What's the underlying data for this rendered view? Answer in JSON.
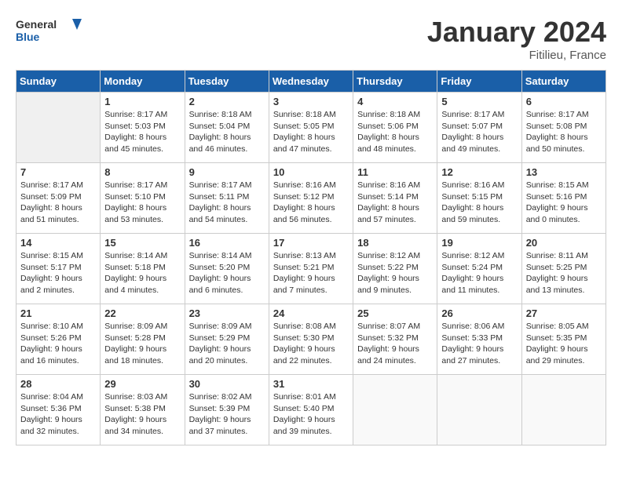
{
  "header": {
    "logo_general": "General",
    "logo_blue": "Blue",
    "month_title": "January 2024",
    "location": "Fitilieu, France"
  },
  "weekdays": [
    "Sunday",
    "Monday",
    "Tuesday",
    "Wednesday",
    "Thursday",
    "Friday",
    "Saturday"
  ],
  "weeks": [
    [
      {
        "day": null,
        "info": null
      },
      {
        "day": "1",
        "info": "Sunrise: 8:17 AM\nSunset: 5:03 PM\nDaylight: 8 hours\nand 45 minutes."
      },
      {
        "day": "2",
        "info": "Sunrise: 8:18 AM\nSunset: 5:04 PM\nDaylight: 8 hours\nand 46 minutes."
      },
      {
        "day": "3",
        "info": "Sunrise: 8:18 AM\nSunset: 5:05 PM\nDaylight: 8 hours\nand 47 minutes."
      },
      {
        "day": "4",
        "info": "Sunrise: 8:18 AM\nSunset: 5:06 PM\nDaylight: 8 hours\nand 48 minutes."
      },
      {
        "day": "5",
        "info": "Sunrise: 8:17 AM\nSunset: 5:07 PM\nDaylight: 8 hours\nand 49 minutes."
      },
      {
        "day": "6",
        "info": "Sunrise: 8:17 AM\nSunset: 5:08 PM\nDaylight: 8 hours\nand 50 minutes."
      }
    ],
    [
      {
        "day": "7",
        "info": "Sunrise: 8:17 AM\nSunset: 5:09 PM\nDaylight: 8 hours\nand 51 minutes."
      },
      {
        "day": "8",
        "info": "Sunrise: 8:17 AM\nSunset: 5:10 PM\nDaylight: 8 hours\nand 53 minutes."
      },
      {
        "day": "9",
        "info": "Sunrise: 8:17 AM\nSunset: 5:11 PM\nDaylight: 8 hours\nand 54 minutes."
      },
      {
        "day": "10",
        "info": "Sunrise: 8:16 AM\nSunset: 5:12 PM\nDaylight: 8 hours\nand 56 minutes."
      },
      {
        "day": "11",
        "info": "Sunrise: 8:16 AM\nSunset: 5:14 PM\nDaylight: 8 hours\nand 57 minutes."
      },
      {
        "day": "12",
        "info": "Sunrise: 8:16 AM\nSunset: 5:15 PM\nDaylight: 8 hours\nand 59 minutes."
      },
      {
        "day": "13",
        "info": "Sunrise: 8:15 AM\nSunset: 5:16 PM\nDaylight: 9 hours\nand 0 minutes."
      }
    ],
    [
      {
        "day": "14",
        "info": "Sunrise: 8:15 AM\nSunset: 5:17 PM\nDaylight: 9 hours\nand 2 minutes."
      },
      {
        "day": "15",
        "info": "Sunrise: 8:14 AM\nSunset: 5:18 PM\nDaylight: 9 hours\nand 4 minutes."
      },
      {
        "day": "16",
        "info": "Sunrise: 8:14 AM\nSunset: 5:20 PM\nDaylight: 9 hours\nand 6 minutes."
      },
      {
        "day": "17",
        "info": "Sunrise: 8:13 AM\nSunset: 5:21 PM\nDaylight: 9 hours\nand 7 minutes."
      },
      {
        "day": "18",
        "info": "Sunrise: 8:12 AM\nSunset: 5:22 PM\nDaylight: 9 hours\nand 9 minutes."
      },
      {
        "day": "19",
        "info": "Sunrise: 8:12 AM\nSunset: 5:24 PM\nDaylight: 9 hours\nand 11 minutes."
      },
      {
        "day": "20",
        "info": "Sunrise: 8:11 AM\nSunset: 5:25 PM\nDaylight: 9 hours\nand 13 minutes."
      }
    ],
    [
      {
        "day": "21",
        "info": "Sunrise: 8:10 AM\nSunset: 5:26 PM\nDaylight: 9 hours\nand 16 minutes."
      },
      {
        "day": "22",
        "info": "Sunrise: 8:09 AM\nSunset: 5:28 PM\nDaylight: 9 hours\nand 18 minutes."
      },
      {
        "day": "23",
        "info": "Sunrise: 8:09 AM\nSunset: 5:29 PM\nDaylight: 9 hours\nand 20 minutes."
      },
      {
        "day": "24",
        "info": "Sunrise: 8:08 AM\nSunset: 5:30 PM\nDaylight: 9 hours\nand 22 minutes."
      },
      {
        "day": "25",
        "info": "Sunrise: 8:07 AM\nSunset: 5:32 PM\nDaylight: 9 hours\nand 24 minutes."
      },
      {
        "day": "26",
        "info": "Sunrise: 8:06 AM\nSunset: 5:33 PM\nDaylight: 9 hours\nand 27 minutes."
      },
      {
        "day": "27",
        "info": "Sunrise: 8:05 AM\nSunset: 5:35 PM\nDaylight: 9 hours\nand 29 minutes."
      }
    ],
    [
      {
        "day": "28",
        "info": "Sunrise: 8:04 AM\nSunset: 5:36 PM\nDaylight: 9 hours\nand 32 minutes."
      },
      {
        "day": "29",
        "info": "Sunrise: 8:03 AM\nSunset: 5:38 PM\nDaylight: 9 hours\nand 34 minutes."
      },
      {
        "day": "30",
        "info": "Sunrise: 8:02 AM\nSunset: 5:39 PM\nDaylight: 9 hours\nand 37 minutes."
      },
      {
        "day": "31",
        "info": "Sunrise: 8:01 AM\nSunset: 5:40 PM\nDaylight: 9 hours\nand 39 minutes."
      },
      {
        "day": null,
        "info": null
      },
      {
        "day": null,
        "info": null
      },
      {
        "day": null,
        "info": null
      }
    ]
  ]
}
